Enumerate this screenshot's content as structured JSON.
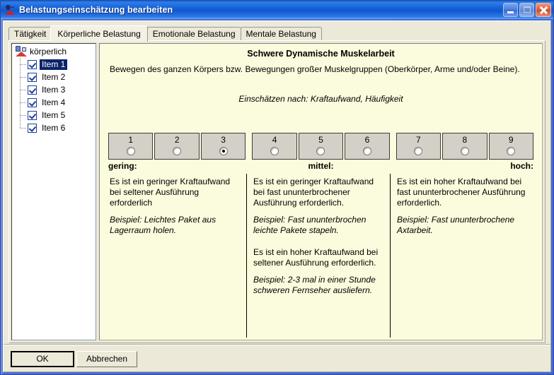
{
  "window": {
    "title": "Belastungseinschätzung bearbeiten",
    "icon": "assessment-icon",
    "buttons": {
      "minimize": "minimize-icon",
      "maximize": "maximize-icon",
      "close": "close-icon"
    }
  },
  "tabs": [
    {
      "label": "Tätigkeit",
      "active": false
    },
    {
      "label": "Körperliche Belastung",
      "active": true
    },
    {
      "label": "Emotionale Belastung",
      "active": false
    },
    {
      "label": "Mentale Belastung",
      "active": false
    }
  ],
  "tree": {
    "root": {
      "label": "körperlich",
      "icon": "load-assessment-icon"
    },
    "items": [
      {
        "label": "Item 1",
        "checked": true,
        "selected": true
      },
      {
        "label": "Item 2",
        "checked": true,
        "selected": false
      },
      {
        "label": "Item 3",
        "checked": true,
        "selected": false
      },
      {
        "label": "Item 4",
        "checked": true,
        "selected": false
      },
      {
        "label": "Item 5",
        "checked": true,
        "selected": false
      },
      {
        "label": "Item 6",
        "checked": true,
        "selected": false
      }
    ]
  },
  "content": {
    "title": "Schwere Dynamische Muskelarbeit",
    "description": "Bewegen des ganzen Körpers bzw. Bewegungen großer Muskelgruppen (Oberkörper, Arme und/oder Beine).",
    "criteria": "Einschätzen nach: Kraftaufwand, Häufigkeit",
    "scale": {
      "selected": 3,
      "groups": [
        {
          "level": "gering:",
          "values": [
            "1",
            "2",
            "3"
          ]
        },
        {
          "level": "mittel:",
          "values": [
            "4",
            "5",
            "6"
          ]
        },
        {
          "level": "hoch:",
          "values": [
            "7",
            "8",
            "9"
          ]
        }
      ]
    },
    "columns": [
      {
        "level": "gering:",
        "paragraphs": [
          {
            "text": "Es ist ein geringer Kraftaufwand bei seltener Ausführung erforderlich",
            "italic": false
          },
          {
            "text": "Beispiel: Leichtes Paket aus Lagerraum holen.",
            "italic": true
          }
        ]
      },
      {
        "level": "mittel:",
        "paragraphs": [
          {
            "text": "Es ist ein geringer Kraftaufwand bei fast ununterbrochener Ausführung erforderlich.",
            "italic": false
          },
          {
            "text": "Beispiel: Fast ununterbrochen leichte Pakete stapeln.",
            "italic": true
          },
          {
            "text": "Es ist ein hoher Kraftaufwand bei seltener Ausführung erforderlich.",
            "italic": false
          },
          {
            "text": "Beispiel: 2-3 mal in einer Stunde schweren Fernseher ausliefern.",
            "italic": true
          }
        ]
      },
      {
        "level": "hoch:",
        "paragraphs": [
          {
            "text": "Es ist ein hoher Kraftaufwand bei fast ununterbrochener Ausführung erforderlich.",
            "italic": false
          },
          {
            "text": "Beispiel: Fast ununterbrochene Axtarbeit.",
            "italic": true
          }
        ]
      }
    ]
  },
  "footer": {
    "ok_label": "OK",
    "cancel_label": "Abbrechen"
  },
  "colors": {
    "titlebar": "#1761d8",
    "content_bg": "#fbfbdd",
    "dialog_bg": "#ece9d8",
    "selection": "#0a246a",
    "close_button": "#cf4f2c"
  }
}
